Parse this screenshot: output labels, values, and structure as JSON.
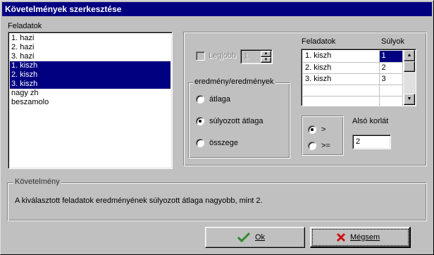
{
  "window": {
    "title": "Követelmények szerkesztése"
  },
  "feladatok": {
    "label": "Feladatok",
    "items": [
      {
        "text": "1. hazi",
        "selected": false
      },
      {
        "text": "2. hazi",
        "selected": false
      },
      {
        "text": "3. hazi",
        "selected": false
      },
      {
        "text": "1. kiszh",
        "selected": true
      },
      {
        "text": "2. kiszh",
        "selected": true
      },
      {
        "text": "3. kiszh",
        "selected": true
      },
      {
        "text": "nagy zh",
        "selected": false
      },
      {
        "text": "beszamolo",
        "selected": false
      }
    ]
  },
  "legjobb": {
    "label": "Legjobb",
    "value": "1",
    "checked": false,
    "enabled": false
  },
  "eredmeny_group": {
    "caption": "eredmény/eredmények",
    "options": [
      {
        "label": "átlaga",
        "checked": false
      },
      {
        "label": "súlyozott átlaga",
        "checked": true
      },
      {
        "label": "összege",
        "checked": false
      }
    ]
  },
  "weights_grid": {
    "col_feladatok": "Feladatok",
    "col_sulyok": "Súlyok",
    "rows": [
      {
        "task": "1. kiszh",
        "weight": "1"
      },
      {
        "task": "2. kiszh",
        "weight": "2"
      },
      {
        "task": "3. kiszh",
        "weight": "3"
      }
    ]
  },
  "comparison": {
    "options": [
      {
        "label": ">",
        "checked": true
      },
      {
        "label": ">=",
        "checked": false
      }
    ]
  },
  "also_korlat": {
    "label": "Alsó korlát",
    "value": "2"
  },
  "kovetelmeny": {
    "caption": "Követelmény",
    "text": "A kiválasztott feladatok eredményének súlyozott átlaga nagyobb, mint 2."
  },
  "buttons": {
    "ok": "Ok",
    "cancel": "Mégsem"
  },
  "colors": {
    "title_bar": "#000080",
    "selection": "#000080",
    "face": "#c0c0c0",
    "ok_check": "#2e8b2e",
    "cancel_x": "#d01010"
  },
  "icons": {
    "ok": "checkmark-icon",
    "cancel": "red-x-icon"
  }
}
